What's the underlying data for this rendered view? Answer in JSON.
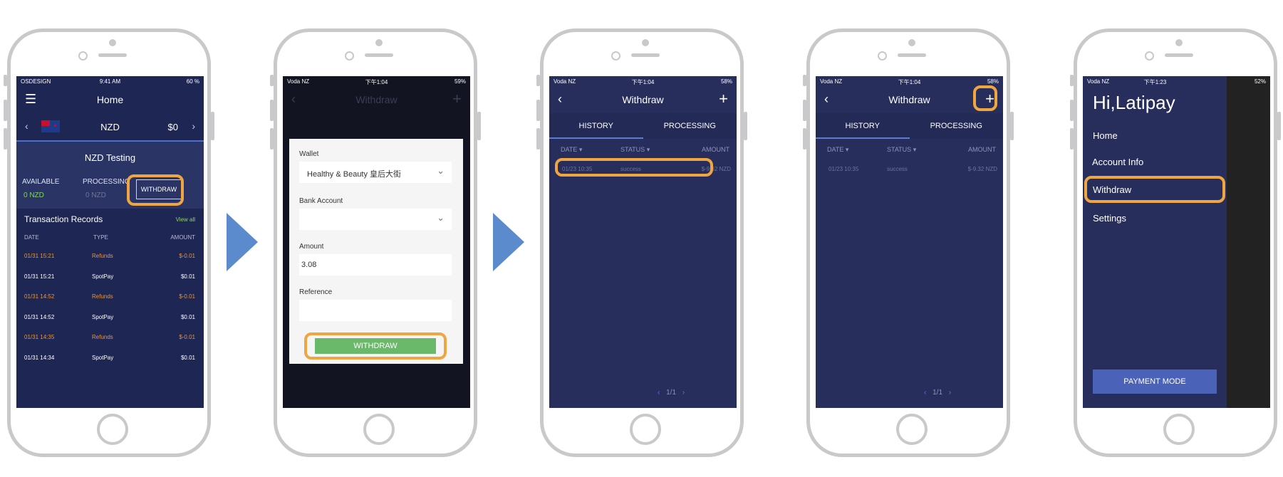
{
  "phone1": {
    "status": {
      "left": "OSDESIGN",
      "center": "9:41 AM",
      "right": "60 %"
    },
    "nav_title": "Home",
    "currency": {
      "code": "NZD",
      "amount": "$0"
    },
    "account_name": "NZD Testing",
    "available_label": "AVAILABLE",
    "available_value": "0 NZD",
    "processing_label": "PROCESSING",
    "processing_value": "0 NZD",
    "withdraw_button": "WITHDRAW",
    "records_title": "Transaction Records",
    "view_all": "View all",
    "columns": [
      "DATE",
      "TYPE",
      "AMOUNT"
    ],
    "records": [
      {
        "date": "01/31 15:21",
        "type": "Refunds",
        "amount": "$-0.01",
        "refund": true
      },
      {
        "date": "01/31 15:21",
        "type": "SpotPay",
        "amount": "$0.01",
        "refund": false
      },
      {
        "date": "01/31 14:52",
        "type": "Refunds",
        "amount": "$-0.01",
        "refund": true
      },
      {
        "date": "01/31 14:52",
        "type": "SpotPay",
        "amount": "$0.01",
        "refund": false
      },
      {
        "date": "01/31 14:35",
        "type": "Refunds",
        "amount": "$-0.01",
        "refund": true
      },
      {
        "date": "01/31 14:34",
        "type": "SpotPay",
        "amount": "$0.01",
        "refund": false
      }
    ]
  },
  "phone2": {
    "status": {
      "left": "Voda NZ",
      "center": "下午1:04",
      "right": "59%"
    },
    "nav_title": "Withdraw",
    "wallet_label": "Wallet",
    "wallet_value": "Healthy & Beauty 皇后大街",
    "bank_label": "Bank Account",
    "amount_label": "Amount",
    "amount_value": "3.08",
    "reference_label": "Reference",
    "withdraw_button": "WITHDRAW"
  },
  "phone3": {
    "status": {
      "left": "Voda NZ",
      "center": "下午1:04",
      "right": "58%"
    },
    "nav_title": "Withdraw",
    "tabs": [
      "HISTORY",
      "PROCESSING"
    ],
    "columns": [
      "DATE",
      "STATUS",
      "AMOUNT"
    ],
    "row": {
      "date": "01/23 10:35",
      "status": "success",
      "amount": "$-9.32 NZD"
    },
    "pager": "1/1"
  },
  "phone4": {
    "status": {
      "left": "Voda NZ",
      "center": "下午1:04",
      "right": "58%"
    },
    "nav_title": "Withdraw",
    "tabs": [
      "HISTORY",
      "PROCESSING"
    ],
    "columns": [
      "DATE",
      "STATUS",
      "AMOUNT"
    ],
    "row": {
      "date": "01/23 10:35",
      "status": "success",
      "amount": "$-9.32 NZD"
    },
    "pager": "1/1"
  },
  "phone5": {
    "status": {
      "left": "Voda NZ",
      "center": "下午1:23",
      "right": "52%"
    },
    "greeting": "Hi,Latipay",
    "menu": [
      "Home",
      "Account Info",
      "Withdraw",
      "Settings"
    ],
    "payment_mode": "PAYMENT MODE"
  },
  "colors": {
    "screen_bg": "#272e5c",
    "highlight": "#f0a640",
    "arrow": "#5b8bcc",
    "refund": "#e6963a",
    "available": "#7ed957",
    "withdraw_green": "#6ab86a"
  }
}
